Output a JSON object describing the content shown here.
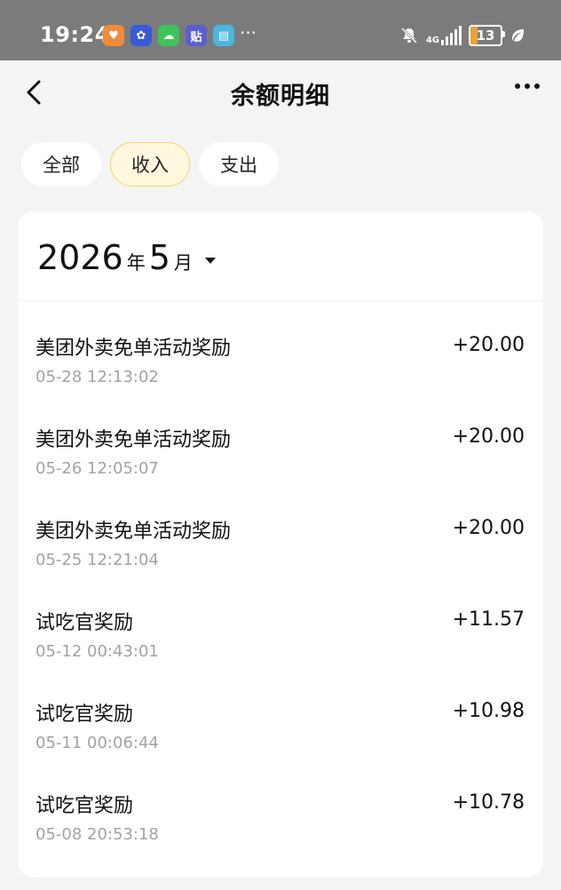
{
  "status_bar": {
    "time": "19:24",
    "more": "···",
    "network": "4G",
    "battery": "13",
    "apps": [
      {
        "icon": "heart-app-icon",
        "color": "#f08c3a",
        "glyph": "♥"
      },
      {
        "icon": "blue-app-icon",
        "color": "#3a5ad8",
        "glyph": "✿"
      },
      {
        "icon": "wechat-icon",
        "color": "#3ec25a",
        "glyph": "☁"
      },
      {
        "icon": "tieba-icon",
        "color": "#5a5fd0",
        "glyph": "贴"
      },
      {
        "icon": "book-icon",
        "color": "#4bb6e0",
        "glyph": "▤"
      }
    ]
  },
  "header": {
    "title": "余额明细"
  },
  "tabs": [
    {
      "label": "全部",
      "active": false
    },
    {
      "label": "收入",
      "active": true
    },
    {
      "label": "支出",
      "active": false
    }
  ],
  "month": {
    "year": "2026",
    "year_unit": "年",
    "month": "5",
    "month_unit": "月"
  },
  "records": [
    {
      "name": "美团外卖免单活动奖励",
      "time": "05-28 12:13:02",
      "amount": "+20.00"
    },
    {
      "name": "美团外卖免单活动奖励",
      "time": "05-26 12:05:07",
      "amount": "+20.00"
    },
    {
      "name": "美团外卖免单活动奖励",
      "time": "05-25 12:21:04",
      "amount": "+20.00"
    },
    {
      "name": "试吃官奖励",
      "time": "05-12 00:43:01",
      "amount": "+11.57"
    },
    {
      "name": "试吃官奖励",
      "time": "05-11 00:06:44",
      "amount": "+10.98"
    },
    {
      "name": "试吃官奖励",
      "time": "05-08 20:53:18",
      "amount": "+10.78"
    }
  ]
}
